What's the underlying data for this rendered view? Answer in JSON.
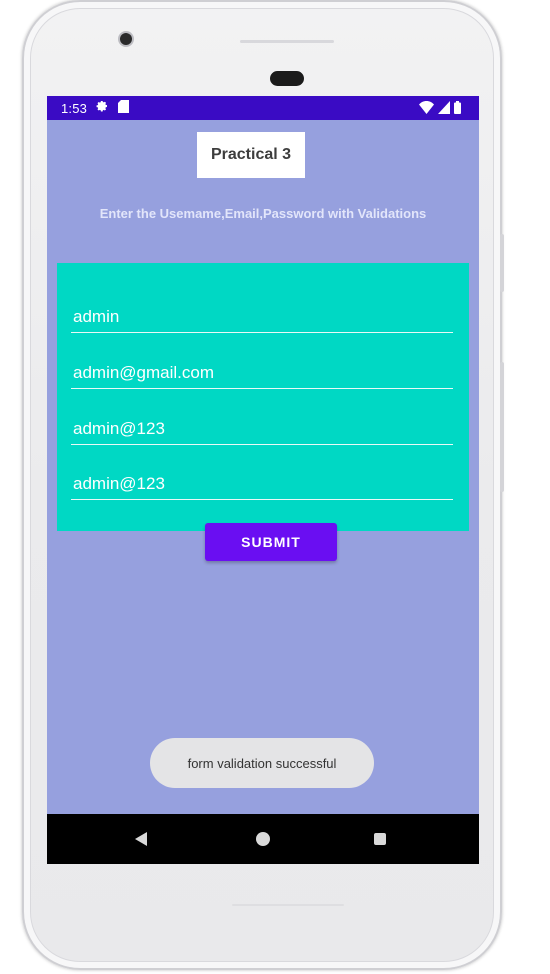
{
  "status_bar": {
    "time": "1:53",
    "left_icons": [
      "settings-icon",
      "sd-card-icon"
    ],
    "right_icons": [
      "wifi-icon",
      "signal-icon",
      "battery-icon"
    ],
    "color": "#3a0bc4"
  },
  "screen": {
    "background": "#96a0de"
  },
  "app": {
    "title": "Practical 3",
    "instruction": "Enter the Usemame,Email,Password with Validations",
    "form_panel_color": "#00d8c4",
    "fields": [
      {
        "name": "username",
        "value": "admin"
      },
      {
        "name": "email",
        "value": "admin@gmail.com"
      },
      {
        "name": "password",
        "value": "admin@123"
      },
      {
        "name": "confirm-password",
        "value": "admin@123"
      }
    ],
    "submit_label": "SUBMIT",
    "submit_color": "#6a0ef2"
  },
  "toast": {
    "message": "form validation successful"
  },
  "nav_bar": {
    "icons": [
      "back-icon",
      "home-icon",
      "recents-icon"
    ]
  }
}
